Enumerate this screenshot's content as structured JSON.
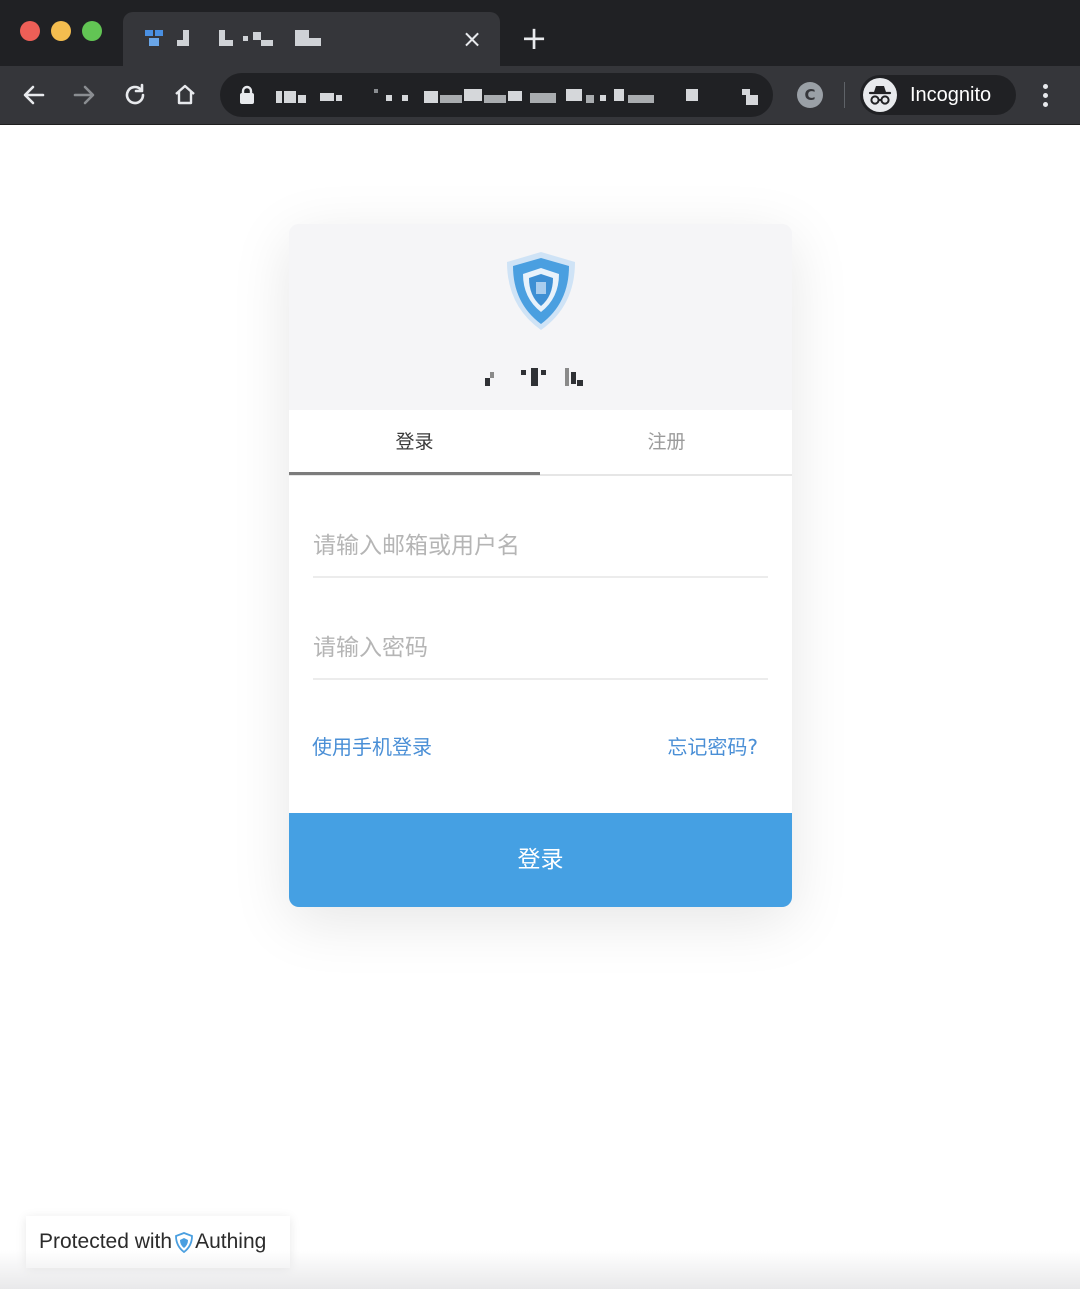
{
  "browser": {
    "mode_label": "Incognito",
    "extension_letter": "C",
    "new_tab_symbol": "+",
    "close_symbol": "×"
  },
  "login": {
    "tabs": [
      {
        "label": "登录",
        "active": true
      },
      {
        "label": "注册",
        "active": false
      }
    ],
    "username_placeholder": "请输入邮箱或用户名",
    "password_placeholder": "请输入密码",
    "phone_login_link": "使用手机登录",
    "forgot_password_link": "忘记密码?",
    "submit_label": "登录"
  },
  "footer": {
    "protected_with": "Protected with",
    "provider": "Authing"
  },
  "colors": {
    "primary": "#45a0e3",
    "link": "#4a8fd6",
    "chrome_dark": "#202124",
    "chrome_toolbar": "#35363a"
  }
}
